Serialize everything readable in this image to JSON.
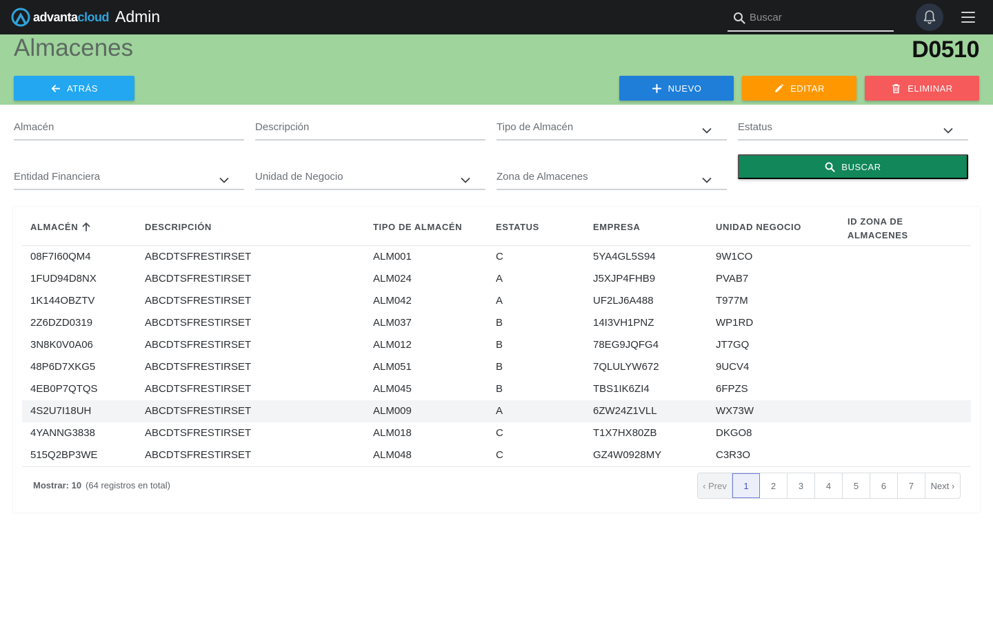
{
  "topbar": {
    "logo_part1": "advanta",
    "logo_part2": "cloud",
    "app_title": "Admin",
    "search_placeholder": "Buscar"
  },
  "header": {
    "title": "Almacenes",
    "code": "D0510",
    "back_label": "ATRÁS",
    "new_label": "NUEVO",
    "edit_label": "EDITAR",
    "delete_label": "ELIMINAR"
  },
  "filters": {
    "almacen": "Almacén",
    "descripcion": "Descripción",
    "tipo": "Tipo de Almacén",
    "estatus": "Estatus",
    "entidad": "Entidad Financiera",
    "unidad": "Unidad de Negocio",
    "zona": "Zona de Almacenes",
    "search_label": "BUSCAR"
  },
  "table": {
    "columns": [
      "ALMACÉN",
      "DESCRIPCIÓN",
      "TIPO DE ALMACÉN",
      "ESTATUS",
      "EMPRESA",
      "UNIDAD NEGOCIO",
      "ID ZONA DE",
      "ALMACENES"
    ],
    "rows": [
      [
        "08F7I60QM4",
        "ABCDTSFRESTIRSET",
        "ALM001",
        "C",
        "5YA4GL5S94",
        "9W1CO"
      ],
      [
        "1FUD94D8NX",
        "ABCDTSFRESTIRSET",
        "ALM024",
        "A",
        "J5XJP4FHB9",
        "PVAB7"
      ],
      [
        "1K144OBZTV",
        "ABCDTSFRESTIRSET",
        "ALM042",
        "A",
        "UF2LJ6A488",
        "T977M"
      ],
      [
        "2Z6DZD0319",
        "ABCDTSFRESTIRSET",
        "ALM037",
        "B",
        "14I3VH1PNZ",
        "WP1RD"
      ],
      [
        "3N8K0V0A06",
        "ABCDTSFRESTIRSET",
        "ALM012",
        "B",
        "78EG9JQFG4",
        "JT7GQ"
      ],
      [
        "48P6D7XKG5",
        "ABCDTSFRESTIRSET",
        "ALM051",
        "B",
        "7QLULYW672",
        "9UCV4"
      ],
      [
        "4EB0P7QTQS",
        "ABCDTSFRESTIRSET",
        "ALM045",
        "B",
        "TBS1IK6ZI4",
        "6FPZS"
      ],
      [
        "4S2U7I18UH",
        "ABCDTSFRESTIRSET",
        "ALM009",
        "A",
        "6ZW24Z1VLL",
        "WX73W"
      ],
      [
        "4YANNG3838",
        "ABCDTSFRESTIRSET",
        "ALM018",
        "C",
        "T1X7HX80ZB",
        "DKGO8"
      ],
      [
        "515Q2BP3WE",
        "ABCDTSFRESTIRSET",
        "ALM048",
        "C",
        "GZ4W0928MY",
        "C3R3O"
      ]
    ],
    "highlighted_row": 7
  },
  "footer": {
    "show_label": "Mostrar: 10",
    "total_label": "(64 registros en total)",
    "prev_label": "‹ Prev",
    "next_label": "Next ›",
    "pages": [
      "1",
      "2",
      "3",
      "4",
      "5",
      "6",
      "7"
    ],
    "active_page": "1"
  },
  "colors": {
    "topbar": "#1b1c1e",
    "header_bg": "#9fd49c",
    "back": "#22a7f0",
    "new": "#1e7ed8",
    "edit": "#ff9800",
    "delete": "#f65a5b",
    "search": "#11875a"
  },
  "icons": {
    "logo": "advanta-cloud-logo-icon",
    "search": "search-icon",
    "bell": "bell-icon",
    "menu": "hamburger-menu-icon",
    "back": "arrow-left-icon",
    "new": "plus-icon",
    "edit": "pencil-icon",
    "delete": "trash-icon",
    "sort": "arrow-up-icon",
    "dropdown": "chevron-down-icon"
  }
}
